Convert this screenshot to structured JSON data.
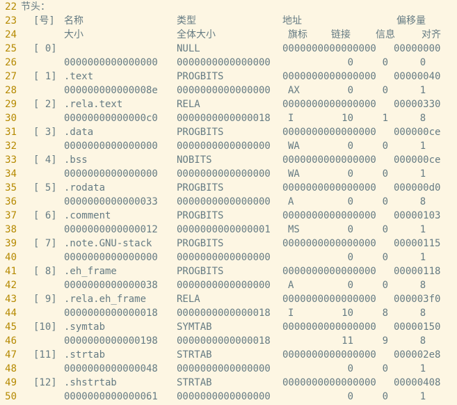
{
  "header": {
    "title": "节头：",
    "row1": {
      "num": "[号]",
      "name": "名称",
      "type": "类型",
      "addr": "地址",
      "offset": "偏移量"
    },
    "row2": {
      "size": "大小",
      "entsize": "全体大小",
      "flags": "旗标",
      "link": "链接",
      "info": "信息",
      "align": "对齐"
    }
  },
  "line_numbers": [
    "22",
    "23",
    "24",
    "25",
    "26",
    "27",
    "28",
    "29",
    "30",
    "31",
    "32",
    "33",
    "34",
    "35",
    "36",
    "37",
    "38",
    "39",
    "40",
    "41",
    "42",
    "43",
    "44",
    "45",
    "46",
    "47",
    "48",
    "49",
    "50"
  ],
  "sections": [
    {
      "num": "[ 0]",
      "name": "",
      "type": "NULL",
      "addr": "0000000000000000",
      "offset": "00000000",
      "size": "0000000000000000",
      "entsize": "0000000000000000",
      "flags": "",
      "link": "0",
      "info": "0",
      "align": "0"
    },
    {
      "num": "[ 1]",
      "name": ".text",
      "type": "PROGBITS",
      "addr": "0000000000000000",
      "offset": "00000040",
      "size": "000000000000008e",
      "entsize": "0000000000000000",
      "flags": "AX",
      "link": "0",
      "info": "0",
      "align": "1"
    },
    {
      "num": "[ 2]",
      "name": ".rela.text",
      "type": "RELA",
      "addr": "0000000000000000",
      "offset": "00000330",
      "size": "00000000000000c0",
      "entsize": "0000000000000018",
      "flags": "I",
      "link": "10",
      "info": "1",
      "align": "8"
    },
    {
      "num": "[ 3]",
      "name": ".data",
      "type": "PROGBITS",
      "addr": "0000000000000000",
      "offset": "000000ce",
      "size": "0000000000000000",
      "entsize": "0000000000000000",
      "flags": "WA",
      "link": "0",
      "info": "0",
      "align": "1"
    },
    {
      "num": "[ 4]",
      "name": ".bss",
      "type": "NOBITS",
      "addr": "0000000000000000",
      "offset": "000000ce",
      "size": "0000000000000000",
      "entsize": "0000000000000000",
      "flags": "WA",
      "link": "0",
      "info": "0",
      "align": "1"
    },
    {
      "num": "[ 5]",
      "name": ".rodata",
      "type": "PROGBITS",
      "addr": "0000000000000000",
      "offset": "000000d0",
      "size": "0000000000000033",
      "entsize": "0000000000000000",
      "flags": "A",
      "link": "0",
      "info": "0",
      "align": "8"
    },
    {
      "num": "[ 6]",
      "name": ".comment",
      "type": "PROGBITS",
      "addr": "0000000000000000",
      "offset": "00000103",
      "size": "0000000000000012",
      "entsize": "0000000000000001",
      "flags": "MS",
      "link": "0",
      "info": "0",
      "align": "1"
    },
    {
      "num": "[ 7]",
      "name": ".note.GNU-stack",
      "type": "PROGBITS",
      "addr": "0000000000000000",
      "offset": "00000115",
      "size": "0000000000000000",
      "entsize": "0000000000000000",
      "flags": "",
      "link": "0",
      "info": "0",
      "align": "1"
    },
    {
      "num": "[ 8]",
      "name": ".eh_frame",
      "type": "PROGBITS",
      "addr": "0000000000000000",
      "offset": "00000118",
      "size": "0000000000000038",
      "entsize": "0000000000000000",
      "flags": "A",
      "link": "0",
      "info": "0",
      "align": "8"
    },
    {
      "num": "[ 9]",
      "name": ".rela.eh_frame",
      "type": "RELA",
      "addr": "0000000000000000",
      "offset": "000003f0",
      "size": "0000000000000018",
      "entsize": "0000000000000018",
      "flags": "I",
      "link": "10",
      "info": "8",
      "align": "8"
    },
    {
      "num": "[10]",
      "name": ".symtab",
      "type": "SYMTAB",
      "addr": "0000000000000000",
      "offset": "00000150",
      "size": "0000000000000198",
      "entsize": "0000000000000018",
      "flags": "",
      "link": "11",
      "info": "9",
      "align": "8"
    },
    {
      "num": "[11]",
      "name": ".strtab",
      "type": "STRTAB",
      "addr": "0000000000000000",
      "offset": "000002e8",
      "size": "0000000000000048",
      "entsize": "0000000000000000",
      "flags": "",
      "link": "0",
      "info": "0",
      "align": "1"
    },
    {
      "num": "[12]",
      "name": ".shstrtab",
      "type": "STRTAB",
      "addr": "0000000000000000",
      "offset": "00000408",
      "size": "0000000000000061",
      "entsize": "0000000000000000",
      "flags": "",
      "link": "0",
      "info": "0",
      "align": "1"
    }
  ],
  "colors": {
    "background": "#fdf6e3",
    "text": "#657b83",
    "line_number": "#b58900"
  }
}
